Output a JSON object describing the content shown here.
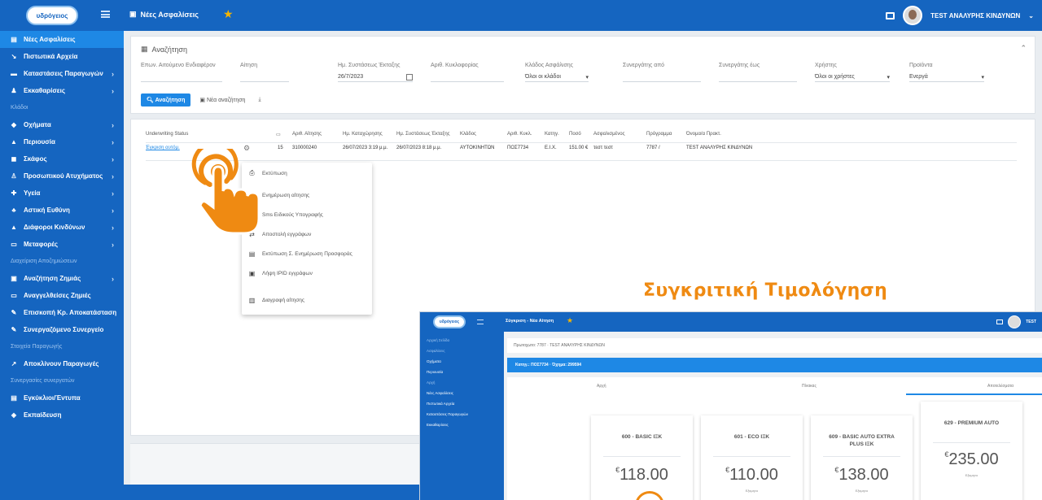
{
  "brand": {
    "logo_text": "υδρόγειος",
    "accent": "#1565c0",
    "highlight": "#ef8a12"
  },
  "topbar": {
    "title": "Νέες Ασφαλίσεις",
    "user": "TEST ΑΝΑΛΥΡΗΣ ΚΙΝΔΥΝΩΝ",
    "icons": [
      "menu-icon",
      "star-icon",
      "message-icon",
      "avatar"
    ]
  },
  "sidebar": {
    "items": [
      {
        "label": "Νέες Ασφαλίσεις",
        "icon": "file-icon",
        "active": true
      },
      {
        "label": "Πιστωτικά Αρχεία",
        "icon": "arrow-icon"
      },
      {
        "label": "Καταστάσεις Παραγωγών",
        "icon": "list-icon",
        "chevron": true
      },
      {
        "label": "Εκκαθαρίσεις",
        "icon": "user-icon",
        "chevron": true
      }
    ],
    "section1": "Κλάδοι",
    "items2": [
      {
        "label": "Οχήματα",
        "icon": "car-icon",
        "chevron": true
      },
      {
        "label": "Περιουσία",
        "icon": "home-icon",
        "chevron": true
      },
      {
        "label": "Σκάφος",
        "icon": "boat-icon",
        "chevron": true
      },
      {
        "label": "Προσωπικού Ατυχήματος",
        "icon": "person-icon",
        "chevron": true
      },
      {
        "label": "Υγεία",
        "icon": "health-icon",
        "chevron": true
      },
      {
        "label": "Αστική Ευθύνη",
        "icon": "scale-icon",
        "chevron": true
      },
      {
        "label": "Διάφοροι Κινδύνων",
        "icon": "warn-icon",
        "chevron": true
      },
      {
        "label": "Μεταφορές",
        "icon": "truck-icon",
        "chevron": true
      }
    ],
    "section2": "Διαχείριση Αποζημιώσεων",
    "items3": [
      {
        "label": "Αναζήτηση Ζημιάς",
        "icon": "search-icon",
        "chevron": true
      },
      {
        "label": "Αναγγελθείσες Ζημιές",
        "icon": "doc-icon"
      },
      {
        "label": "Επισκοπή Κρ. Αποκατάσταση",
        "icon": "tool-icon"
      },
      {
        "label": "Συνεργαζόμενο Συνεργείο",
        "icon": "tool2-icon"
      }
    ],
    "section3": "Στοιχεία Παραγωγής",
    "items4": [
      {
        "label": "Αποκλίνουν Παραγωγές",
        "icon": "trend-icon"
      }
    ],
    "section4": "Συνεργασίες συνεργατών",
    "items5": [
      {
        "label": "Εγκύκλιοι/Έντυπα",
        "icon": "folder-icon"
      },
      {
        "label": "Εκπαίδευση",
        "icon": "cap-icon"
      }
    ]
  },
  "search": {
    "heading": "Αναζήτηση",
    "fields": [
      {
        "label": "Επων. Αιτούμενο Ενδιαφέρον",
        "value": ""
      },
      {
        "label": "Αίτηση",
        "value": ""
      },
      {
        "label": "Ημ. Συστάσεως Έκταξης",
        "value": "26/7/2023"
      },
      {
        "label": "Αριθ. Κυκλοφορίας",
        "value": ""
      },
      {
        "label": "Κλάδος Ασφάλισης",
        "value": "Όλοι οι κλάδοι"
      },
      {
        "label": "Συνεργάτης από",
        "value": ""
      },
      {
        "label": "Συνεργάτης έως",
        "value": ""
      },
      {
        "label": "Χρήστης",
        "value": "Όλοι οι χρήστες"
      },
      {
        "label": "Προϊόντα",
        "value": "Ενεργά"
      }
    ],
    "btn_search": "Αναζήτηση",
    "btn_new": "Νέα αναζήτηση"
  },
  "table": {
    "headers": [
      "Underwriting Status",
      "",
      "",
      "Αριθ. Αίτησης",
      "Ημ. Καταχώρησης",
      "Ημ. Συστάσεως Έκταξης",
      "Κλάδος",
      "Αριθ. Κυκλ.",
      "Κατηγ.",
      "Ποσό",
      "Ασφαλισμένος",
      "Πρόγραμμα",
      "Όνομα/α Πρακτ."
    ],
    "rows": [
      [
        "Έγκριση αυτόμ.",
        "",
        "15",
        "310000240",
        "26/07/2023 3:19 μ.μ.",
        "26/07/2023 8:18 μ.μ.",
        "ΑΥΤΟΚΙΝΗΤΩΝ",
        "ΠΟΣ7734",
        "Ε.Ι.Χ.",
        "151.00 €",
        "τεστ τεστ",
        "7787 / ",
        "TEST ΑΝΑΛΥΡΗΣ ΚΙΝΔΥΝΩΝ"
      ]
    ]
  },
  "context_menu": [
    {
      "label": "Εκτύπωση",
      "icon": "print-icon"
    },
    {
      "label": "Ενημέρωση αίτησης",
      "icon": "edit-icon"
    },
    {
      "label": "Sms Ειδικούς Υπογραφής",
      "icon": "sms-icon"
    },
    {
      "label": "Αποστολή εγγράφων",
      "icon": "send-icon"
    },
    {
      "label": "Εκτύπωση Σ. Ενημέρωση Προσφοράς",
      "icon": "doc2-icon"
    },
    {
      "label": "Λήψη IPID εγγράφων",
      "icon": "download-icon"
    },
    {
      "label": "Διαγραφή αίτησης",
      "icon": "trash-icon"
    }
  ],
  "caption": "Συγκριτική Τιμολόγηση",
  "inset": {
    "title": "Σύγκριση - Νέα Αίτηση",
    "user": "TEST",
    "breadcrumb": "Πρωτοχωτο: 7787 · TEST ΑΝΑΛΥΡΗΣ ΚΙΝΔΥΝΩΝ",
    "bar_text": "Κατηγ.: ΠΟΣ7734 · Όχημα: 299594",
    "tabs": [
      "Αρχή",
      "Πίνακας",
      "Αποτελέσματα"
    ],
    "nav": [
      "Αρχική Σελίδα",
      "Ασφαλίσεις",
      "Οχήματα",
      "Περιουσία",
      "Αρχή",
      "Νέες Ασφαλίσεις",
      "Πιστωτικά Αρχεία",
      "Καταστάσεις Παραγωγών",
      "Εκκαθαρίσεις"
    ],
    "plans": [
      {
        "name": "600 - BASIC ΙΞΚ",
        "price": "118.00",
        "currency": "€",
        "sub": ""
      },
      {
        "name": "601 - ECO ΙΞΚ",
        "price": "110.00",
        "currency": "€",
        "sub": "Εξαμηνο"
      },
      {
        "name": "609 - BASIC AUTO EXTRA PLUS ΙΞΚ",
        "price": "138.00",
        "currency": "€",
        "sub": "Εξαμηνο"
      },
      {
        "name": "629 - PREMIUM AUTO",
        "price": "235.00",
        "currency": "€",
        "sub": "Εξαμηνο"
      }
    ]
  }
}
